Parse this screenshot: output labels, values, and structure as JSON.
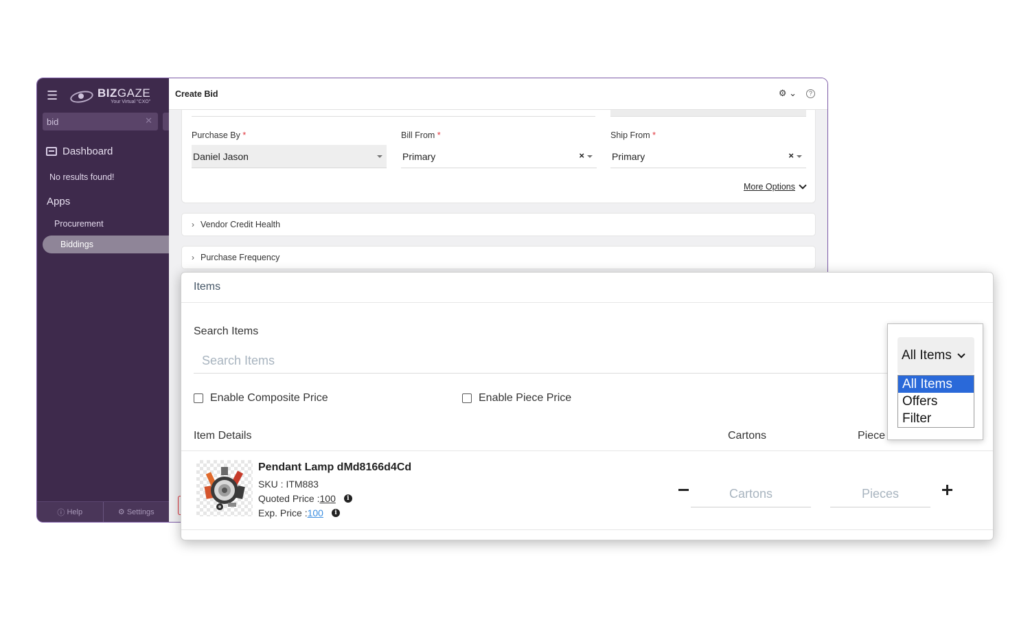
{
  "sidebar": {
    "logo_name_bold": "BIZ",
    "logo_name_light": "GAZE",
    "logo_tagline": "Your Virtual \"CXO\"",
    "search_value": "bid",
    "dashboard_label": "Dashboard",
    "no_results": "No results found!",
    "apps_label": "Apps",
    "procurement_label": "Procurement",
    "biddings_label": "Biddings",
    "help_label": "Help",
    "settings_label": "Settings"
  },
  "header": {
    "title": "Create Bid"
  },
  "form": {
    "purchase_by": {
      "label": "Purchase By",
      "value": "Daniel Jason"
    },
    "bill_from": {
      "label": "Bill From",
      "value": "Primary"
    },
    "ship_from": {
      "label": "Ship From",
      "value": "Primary"
    },
    "required_mark": "*",
    "more_options": "More Options"
  },
  "sections": {
    "vendor_credit_health": "Vendor Credit Health",
    "purchase_frequency": "Purchase Frequency"
  },
  "items_panel": {
    "title": "Items",
    "search_label": "Search Items",
    "search_placeholder": "Search Items",
    "enable_composite_price": "Enable Composite Price",
    "enable_piece_price": "Enable Piece Price",
    "columns": {
      "item_details": "Item Details",
      "cartons": "Cartons",
      "pieces": "Piece"
    },
    "item": {
      "name": "Pendant Lamp dMd8166d4Cd",
      "sku": "SKU : ITM883",
      "quoted_price_label": "Quoted Price :",
      "quoted_price_value": "100",
      "exp_price_label": "Exp. Price : ",
      "exp_price_value": "100 ",
      "cartons_placeholder": "Cartons",
      "pieces_placeholder": "Pieces"
    }
  },
  "filter": {
    "selected": "All Items",
    "options": [
      "All Items",
      "Offers",
      "Filter"
    ]
  },
  "colors": {
    "sidebar_bg": "#3e2a4c",
    "accent_purple": "#7c5aa6",
    "required_red": "#e0343c",
    "link_blue": "#3a8de0",
    "selected_option": "#2a69d9"
  }
}
